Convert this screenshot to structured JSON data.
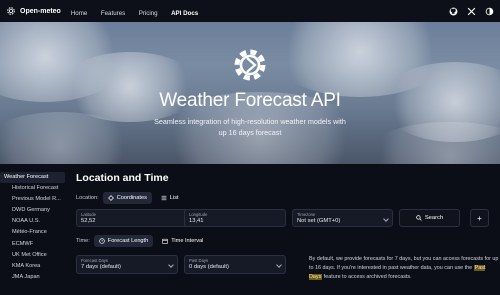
{
  "header": {
    "brand": "Open-meteo",
    "nav": [
      "Home",
      "Features",
      "Pricing",
      "API Docs"
    ],
    "icons": [
      "github-icon",
      "x-icon",
      "theme-toggle-icon"
    ]
  },
  "hero": {
    "title": "Weather Forecast API",
    "subtitle": "Seamless integration of high-resolution weather models with up 16 days forecast"
  },
  "sidebar": {
    "items": [
      "Weather Forecast",
      "Historical Forecast",
      "Previous Model R...",
      "DWD Germany",
      "NOAA U.S.",
      "Météo-France",
      "ECMWF",
      "UK Met Office",
      "KMA Korea",
      "JMA Japan"
    ]
  },
  "main": {
    "title": "Location and Time",
    "location_label": "Location:",
    "location_tabs": [
      "Coordinates",
      "List"
    ],
    "latitude": {
      "label": "Latitude",
      "value": "52,52"
    },
    "longitude": {
      "label": "Longitude",
      "value": "13,41"
    },
    "timezone": {
      "label": "Timezone",
      "value": "Not set (GMT+0)"
    },
    "search_label": "Search",
    "add_label": "+",
    "time_label": "Time:",
    "time_tabs": [
      "Forecast Length",
      "Time Interval"
    ],
    "forecast_days": {
      "label": "Forecast Days",
      "value": "7 days (default)"
    },
    "past_days": {
      "label": "Past Days",
      "value": "0 days (default)"
    },
    "note_before": "By default, we provide forecasts for 7 days, but you can access forecasts for up to 16 days. If you're interested in past weather data, you can use the",
    "note_highlight": "Past Days",
    "note_after": "feature to access archived forecasts."
  },
  "colors": {
    "background": "#0b0e16",
    "highlight": "#6a5a1c"
  }
}
